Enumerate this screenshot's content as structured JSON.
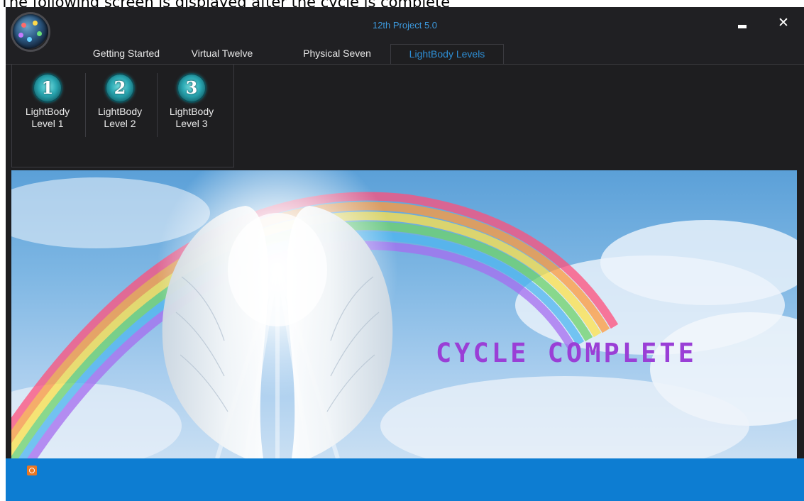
{
  "caption": "The following screen is displayed after the cycle is complete",
  "window": {
    "title": "12th Project 5.0"
  },
  "tabs": [
    {
      "label": "Getting Started",
      "active": false
    },
    {
      "label": "Virtual Twelve",
      "active": false
    },
    {
      "label": "Physical Seven",
      "active": false
    },
    {
      "label": "LightBody Levels",
      "active": true
    }
  ],
  "ribbon": {
    "buttons": [
      {
        "number": "1",
        "line1": "LightBody",
        "line2": "Level 1"
      },
      {
        "number": "2",
        "line1": "LightBody",
        "line2": "Level 2"
      },
      {
        "number": "3",
        "line1": "LightBody",
        "line2": "Level 3"
      }
    ]
  },
  "stage": {
    "message": "CYCLE COMPLETE"
  },
  "icons": {
    "app_logo": "orb-logo-icon",
    "minimize": "minimize-icon",
    "close": "close-icon",
    "status": "ubuntu-icon"
  },
  "colors": {
    "accent": "#2e8fd6",
    "statusbar": "#0d7dd2",
    "message": "#9a3fd6",
    "background": "#1e1e20"
  }
}
